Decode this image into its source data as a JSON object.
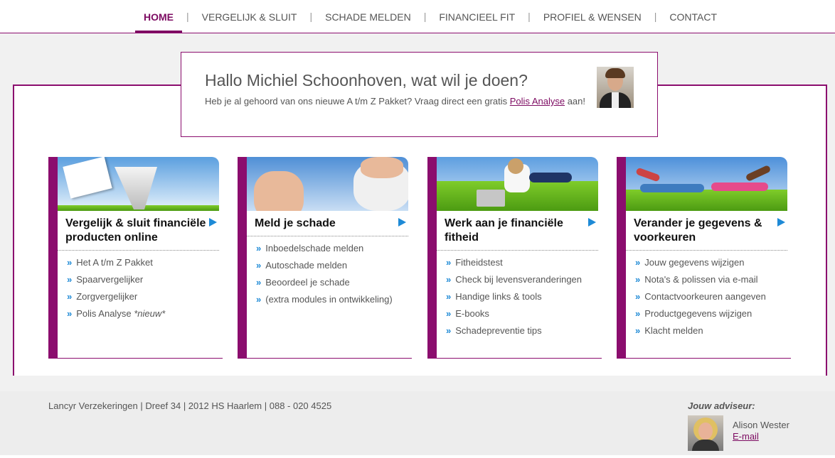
{
  "nav": {
    "items": [
      {
        "label": "HOME",
        "active": true
      },
      {
        "label": "VERGELIJK & SLUIT"
      },
      {
        "label": "SCHADE MELDEN"
      },
      {
        "label": "FINANCIEEL FIT"
      },
      {
        "label": "PROFIEL & WENSEN"
      },
      {
        "label": "CONTACT"
      }
    ],
    "separator": "|"
  },
  "welcome": {
    "greeting": "Hallo Michiel Schoonhoven, wat wil je doen?",
    "text_before": "Heb je al gehoord van ons nieuwe A t/m Z Pakket? Vraag direct een gratis ",
    "link": "Polis Analyse",
    "text_after": " aan!"
  },
  "cards": [
    {
      "title": "Vergelijk & sluit financiële producten online",
      "items": [
        "Het A t/m Z Pakket",
        "Spaarvergelijker",
        "Zorgvergelijker",
        "Polis Analyse"
      ],
      "item_suffix_3": "*nieuw*"
    },
    {
      "title": "Meld je schade",
      "items": [
        "Inboedelschade melden",
        "Autoschade melden",
        "Beoordeel je schade",
        "(extra modules in ontwikkeling)"
      ]
    },
    {
      "title": "Werk aan je financiële fitheid",
      "items": [
        "Fitheidstest",
        "Check bij levensveranderingen",
        "Handige links & tools",
        "E-books",
        "Schadepreventie tips"
      ]
    },
    {
      "title": "Verander je gegevens & voorkeuren",
      "items": [
        "Jouw gegevens wijzigen",
        "Nota's & polissen via e-mail",
        "Contactvoorkeuren aangeven",
        "Productgegevens wijzigen",
        "Klacht melden"
      ]
    }
  ],
  "bullet": "»",
  "footer": {
    "address": "Lancyr Verzekeringen | Dreef 34 | 2012 HS Haarlem | 088 - 020 4525",
    "advisor_label": "Jouw adviseur:",
    "advisor_name": "Alison Wester",
    "advisor_email": "E-mail"
  },
  "colors": {
    "brand": "#8b0d6e",
    "accent": "#1e8ad6"
  }
}
